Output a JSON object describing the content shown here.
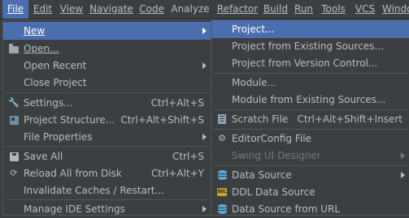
{
  "menubar": [
    {
      "label": "File",
      "active": true
    },
    {
      "label": "Edit"
    },
    {
      "label": "View"
    },
    {
      "label": "Navigate"
    },
    {
      "label": "Code"
    },
    {
      "label": "Analyze"
    },
    {
      "label": "Refactor"
    },
    {
      "label": "Build"
    },
    {
      "label": "Run"
    },
    {
      "label": "Tools"
    },
    {
      "label": "VCS"
    },
    {
      "label": "Windo"
    }
  ],
  "file_menu": {
    "new": {
      "label": "New"
    },
    "open": {
      "label": "Open...",
      "icon": "folder-open-icon"
    },
    "open_recent": {
      "label": "Open Recent"
    },
    "close_project": {
      "label": "Close Project"
    },
    "settings": {
      "label": "Settings...",
      "shortcut": "Ctrl+Alt+S",
      "icon": "wrench-icon"
    },
    "project_structure": {
      "label": "Project Structure...",
      "shortcut": "Ctrl+Alt+Shift+S",
      "icon": "project-structure-icon"
    },
    "file_properties": {
      "label": "File Properties"
    },
    "save_all": {
      "label": "Save All",
      "shortcut": "Ctrl+S",
      "icon": "save-icon"
    },
    "reload": {
      "label": "Reload All from Disk",
      "shortcut": "Ctrl+Alt+Y",
      "icon": "reload-icon"
    },
    "invalidate": {
      "label": "Invalidate Caches / Restart..."
    },
    "manage_ide": {
      "label": "Manage IDE Settings"
    }
  },
  "new_submenu": {
    "project": {
      "label": "Project..."
    },
    "project_existing": {
      "label": "Project from Existing Sources..."
    },
    "project_vcs": {
      "label": "Project from Version Control..."
    },
    "module": {
      "label": "Module..."
    },
    "module_existing": {
      "label": "Module from Existing Sources..."
    },
    "scratch": {
      "label": "Scratch File",
      "shortcut": "Ctrl+Alt+Shift+Insert",
      "icon": "scratch-file-icon"
    },
    "editorconfig": {
      "label": "EditorConfig File",
      "icon": "gear-icon"
    },
    "swing": {
      "label": "Swing UI Designer"
    },
    "data_source": {
      "label": "Data Source",
      "icon": "database-icon"
    },
    "ddl_data_source": {
      "label": "DDL Data Source",
      "icon": "ddl-icon"
    },
    "ds_url": {
      "label": "Data Source from URL",
      "icon": "database-url-icon"
    }
  },
  "colors": {
    "background": "#3c3f41",
    "selection": "#4b6eaf",
    "text": "#bbbbbb",
    "disabled_text": "#777777"
  }
}
